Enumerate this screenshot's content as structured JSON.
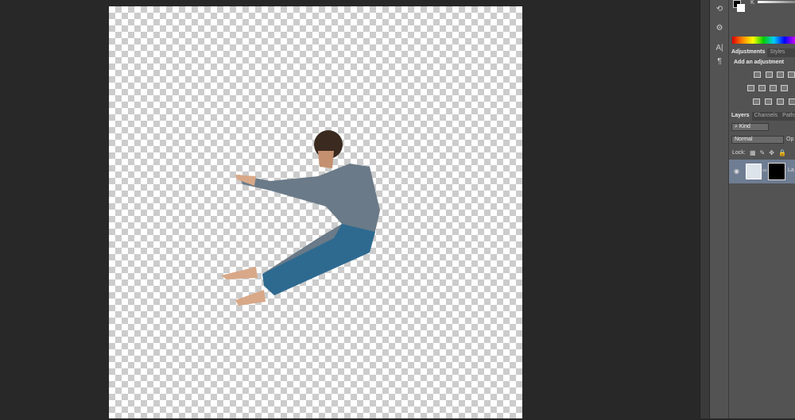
{
  "color_panel": {
    "channel_label": "K"
  },
  "adjustments": {
    "tabs": [
      "Adjustments",
      "Styles"
    ],
    "heading": "Add an adjustment"
  },
  "layers": {
    "tabs": [
      "Layers",
      "Channels",
      "Paths"
    ],
    "filter_kind": "Kind",
    "blend_mode": "Normal",
    "opacity_label": "Op",
    "lock_label": "Lock:",
    "layer_name": "La"
  },
  "colors": {
    "bg": "#282828",
    "panel": "#535353",
    "selected_layer": "#6f7d93"
  }
}
